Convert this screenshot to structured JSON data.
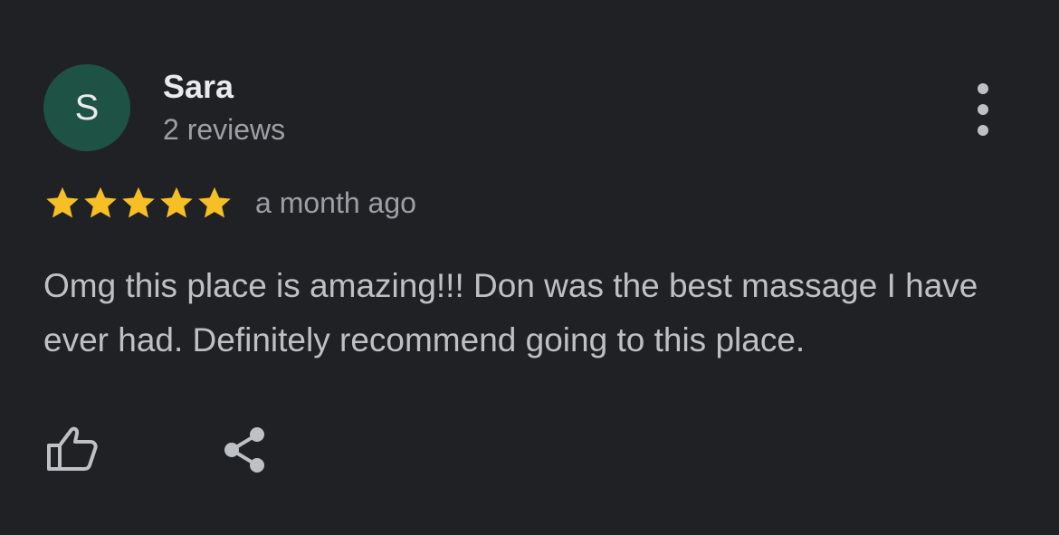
{
  "review": {
    "avatar_letter": "S",
    "avatar_color": "#1e5245",
    "author_name": "Sara",
    "review_count": "2 reviews",
    "rating": 5,
    "rating_max": 5,
    "star_color": "#f6bf26",
    "time_ago": "a month ago",
    "text": "Omg this place is amazing!!! Don was the best massage I have ever had. Definitely recommend going to this place.",
    "menu_icon": "more-vert-icon",
    "actions": {
      "like_icon": "thumbs-up-icon",
      "share_icon": "share-icon"
    }
  },
  "colors": {
    "background": "#202124",
    "primary_text": "#e8eaed",
    "secondary_text": "#9aa0a6",
    "body_text": "#bdc1c6"
  }
}
